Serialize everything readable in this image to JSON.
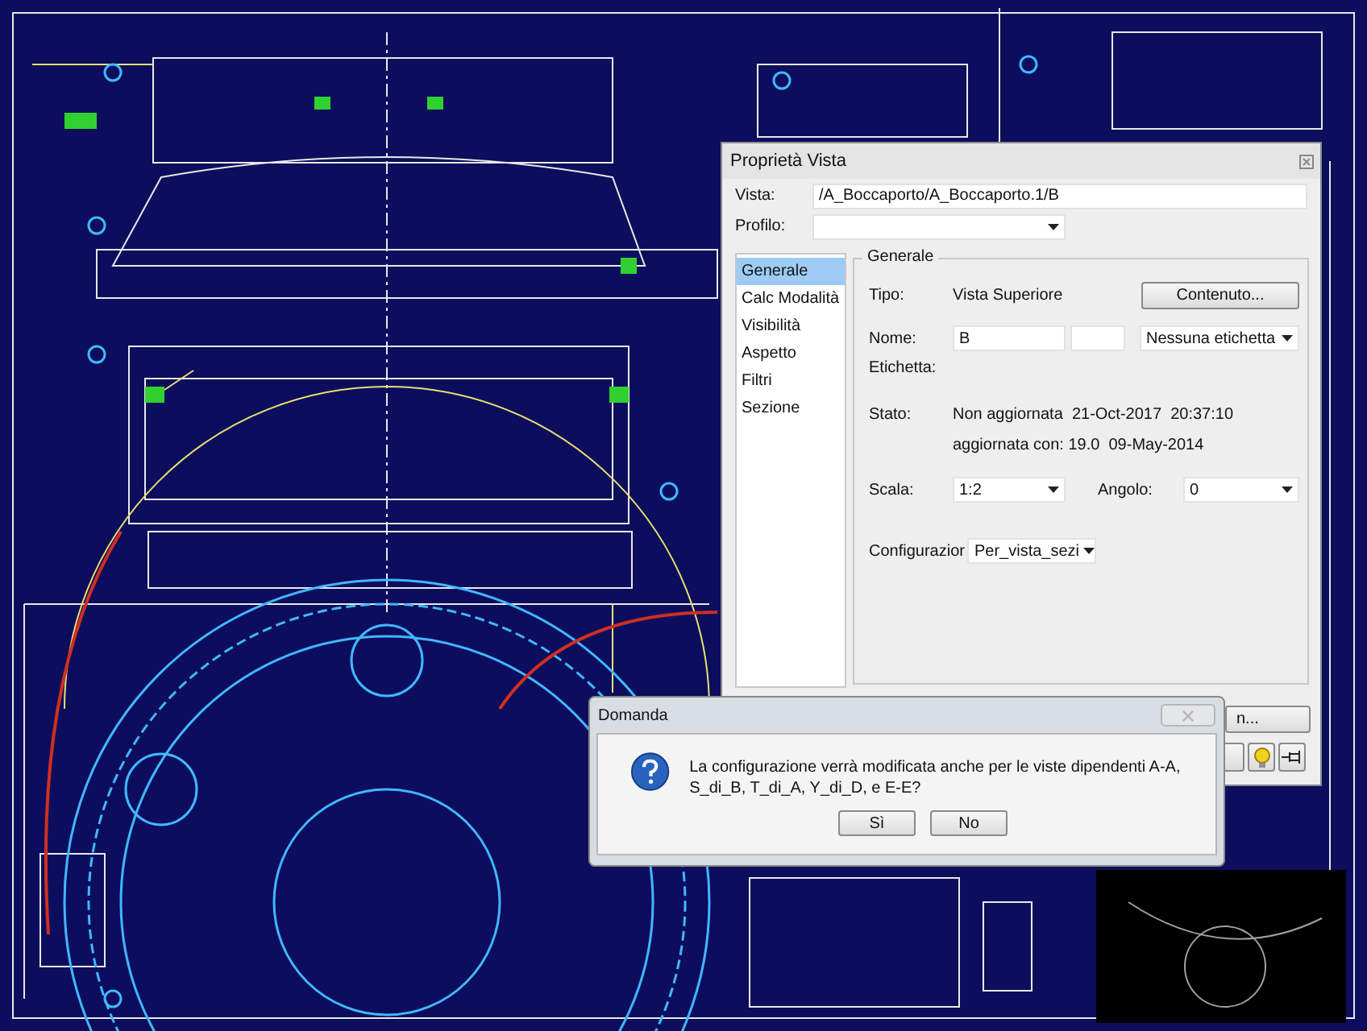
{
  "properties_window": {
    "title": "Proprietà Vista",
    "vista": {
      "label": "Vista:",
      "value": "/A_Boccaporto/A_Boccaporto.1/B"
    },
    "profilo": {
      "label": "Profilo:"
    },
    "nav": [
      {
        "label": "Generale",
        "selected": true
      },
      {
        "label": "Calc Modalità",
        "selected": false
      },
      {
        "label": "Visibilità",
        "selected": false
      },
      {
        "label": "Aspetto",
        "selected": false
      },
      {
        "label": "Filtri",
        "selected": false
      },
      {
        "label": "Sezione",
        "selected": false
      }
    ],
    "group": {
      "title": "Generale",
      "tipo": {
        "label": "Tipo:",
        "value": "Vista Superiore",
        "button": "Contenuto..."
      },
      "nome": {
        "label": "Nome:",
        "value": "B",
        "tag_dropdown": "Nessuna etichetta"
      },
      "etichetta": {
        "label": "Etichetta:"
      },
      "stato": {
        "label": "Stato:",
        "line_1": "Non aggiornata  21-Oct-2017  20:37:10",
        "line_2": "aggiornata con: 19.0  09-May-2014"
      },
      "scala": {
        "label": "Scala:",
        "value": "1:2"
      },
      "angolo": {
        "label": "Angolo:",
        "value": "0"
      },
      "configurazione": {
        "label": "Configurazior",
        "value": "Per_vista_sezi"
      }
    },
    "partial_button": "n..."
  },
  "question_dialog": {
    "title": "Domanda",
    "message": "La configurazione verrà modificata anche per le viste dipendenti A-A, S_di_B, T_di_A, Y_di_D, e E-E?",
    "buttons": [
      "Sì",
      "No"
    ]
  }
}
